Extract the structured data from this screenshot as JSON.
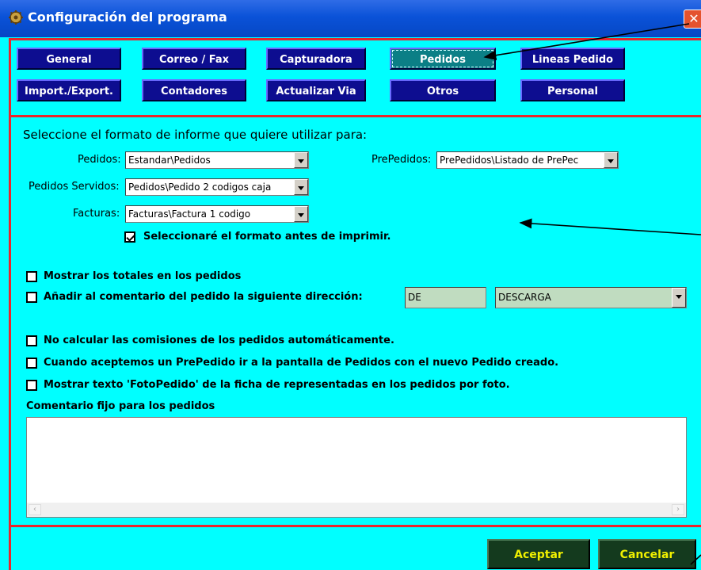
{
  "window": {
    "title": "Configuración del programa",
    "close_label": "✕"
  },
  "tabs_row1": [
    "General",
    "Correo / Fax",
    "Capturadora",
    "Pedidos",
    "Lineas Pedido"
  ],
  "tabs_row2": [
    "Import./Export.",
    "Contadores",
    "Actualizar Via",
    "Otros",
    "Personal"
  ],
  "active_tab": "Pedidos",
  "format": {
    "heading": "Seleccione el formato de informe que quiere utilizar para:",
    "pedidos_label": "Pedidos:",
    "pedidos_value": "Estandar\\Pedidos",
    "prepedidos_label": "PrePedidos:",
    "prepedidos_value": "PrePedidos\\Listado de PrePec",
    "servidos_label": "Pedidos Servidos:",
    "servidos_value": "Pedidos\\Pedido 2 codigos caja",
    "facturas_label": "Facturas:",
    "facturas_value": "Facturas\\Factura 1 codigo",
    "select_before_label": "Seleccionaré el formato antes de imprimir.",
    "select_before_checked": true
  },
  "options": {
    "mostrar_totales": "Mostrar los totales en los pedidos",
    "anadir_comentario": "Añadir al comentario del pedido la siguiente dirección:",
    "direccion_code": "DE",
    "direccion_value": "DESCARGA",
    "no_calcular": "No calcular las comisiones de los pedidos automáticamente.",
    "prepedido_ir": "Cuando aceptemos un PrePedido ir a la pantalla de Pedidos con el nuevo Pedido creado.",
    "foto_pedido": "Mostrar texto 'FotoPedido' de la ficha de representadas en los pedidos por foto."
  },
  "comentario": {
    "label": "Comentario fijo para los pedidos",
    "value": ""
  },
  "buttons": {
    "accept": "Aceptar",
    "cancel": "Cancelar"
  },
  "colors": {
    "background": "#00ffff",
    "tab_button": "#0d0d90",
    "action_button": "#143a1e",
    "frame": "#e8262c"
  }
}
